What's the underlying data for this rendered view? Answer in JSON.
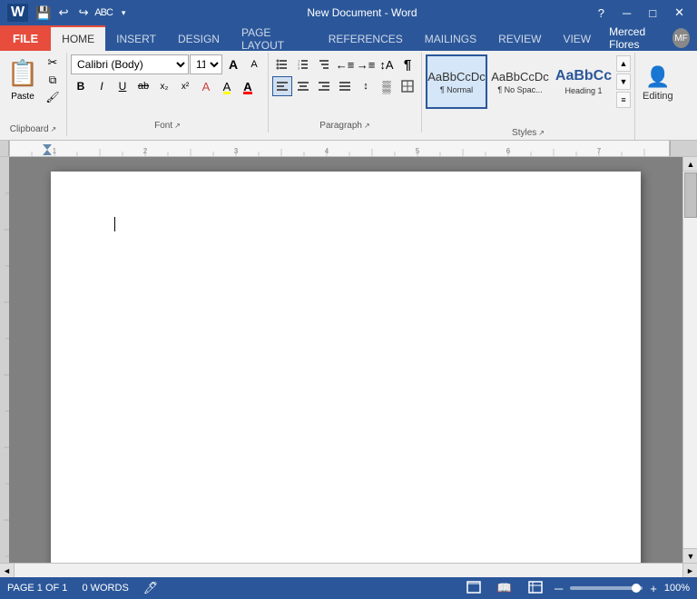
{
  "titlebar": {
    "title": "New Document - Word",
    "help_btn": "?",
    "minimize_btn": "─",
    "restore_btn": "□",
    "close_btn": "✕"
  },
  "qat": {
    "save_label": "💾",
    "undo_label": "↩",
    "redo_label": "↪",
    "abc_label": "ABC",
    "dropdown_label": "▾"
  },
  "ribbon": {
    "file_label": "FILE",
    "tabs": [
      "HOME",
      "INSERT",
      "DESIGN",
      "PAGE LAYOUT",
      "REFERENCES",
      "MAILINGS",
      "REVIEW",
      "VIEW"
    ],
    "active_tab": "HOME",
    "user_name": "Merced Flores"
  },
  "clipboard": {
    "paste_label": "Paste",
    "cut_label": "✂",
    "copy_label": "⧉",
    "format_label": "🖌",
    "group_label": "Clipboard"
  },
  "font": {
    "family": "Calibri (Body)",
    "size": "11",
    "bold": "B",
    "italic": "I",
    "underline": "U",
    "strikethrough": "ab",
    "subscript": "x₂",
    "superscript": "x²",
    "clear": "A",
    "highlight": "A",
    "color": "A",
    "grow": "A",
    "shrink": "A",
    "group_label": "Font"
  },
  "paragraph": {
    "bullets_label": "≡",
    "numbering_label": "≡",
    "multilevel_label": "≡",
    "decrease_indent": "←",
    "increase_indent": "→",
    "sort_label": "↕",
    "show_marks": "¶",
    "align_left": "≡",
    "align_center": "≡",
    "align_right": "≡",
    "justify": "≡",
    "line_spacing": "↕",
    "shading": "▪",
    "borders": "□",
    "group_label": "Paragraph"
  },
  "styles": {
    "items": [
      {
        "preview": "AaBbCcDc",
        "label": "¶ Normal",
        "active": true
      },
      {
        "preview": "AaBbCcDc",
        "label": "¶ No Spac...",
        "active": false
      },
      {
        "preview": "AaBbCc",
        "label": "Heading 1",
        "active": false
      }
    ],
    "group_label": "Styles"
  },
  "editing": {
    "icon": "👤",
    "label": "Editing",
    "group_label": "Editing"
  },
  "document": {
    "cursor_visible": true
  },
  "statusbar": {
    "page_info": "PAGE 1 OF 1",
    "words": "0 WORDS",
    "lang_icon": "🖊",
    "view_icons": [
      "▤",
      "▦",
      "⊞"
    ],
    "zoom_percent": "100%",
    "zoom_label": "─"
  }
}
